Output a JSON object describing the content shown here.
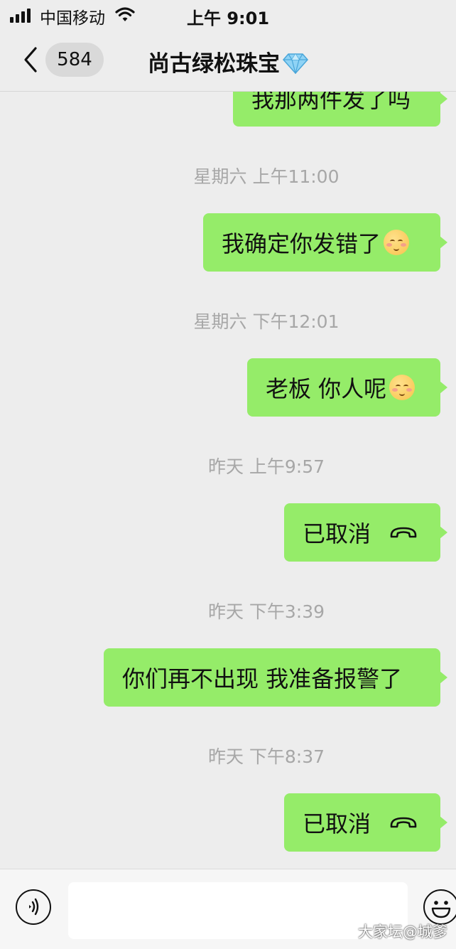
{
  "status_bar": {
    "carrier": "中国移动",
    "time": "上午 9:01"
  },
  "nav": {
    "unread_count": "584",
    "title": "尚古绿松珠宝",
    "title_icon": "diamond-icon"
  },
  "messages": [
    {
      "type": "bubble",
      "text": "我那两件发了吗"
    },
    {
      "type": "time",
      "text": "星期六 上午11:00"
    },
    {
      "type": "bubble",
      "text": "我确定你发错了",
      "emoji": "pleading-face"
    },
    {
      "type": "time",
      "text": "星期六 下午12:01"
    },
    {
      "type": "bubble",
      "text": "老板 你人呢",
      "emoji": "pleading-face"
    },
    {
      "type": "time",
      "text": "昨天 上午9:57"
    },
    {
      "type": "call",
      "text": "已取消",
      "icon": "phone-hangup-icon"
    },
    {
      "type": "time",
      "text": "昨天 下午3:39"
    },
    {
      "type": "bubble",
      "text": "你们再不出现 我准备报警了"
    },
    {
      "type": "time",
      "text": "昨天 下午8:37"
    },
    {
      "type": "call",
      "text": "已取消",
      "icon": "phone-hangup-icon"
    }
  ],
  "input_bar": {
    "voice_icon": "voice-icon",
    "emoji_icon": "emoji-icon",
    "text_value": ""
  },
  "watermark": "大家坛@城爹",
  "colors": {
    "bubble": "#95ec69",
    "background": "#ededed"
  }
}
